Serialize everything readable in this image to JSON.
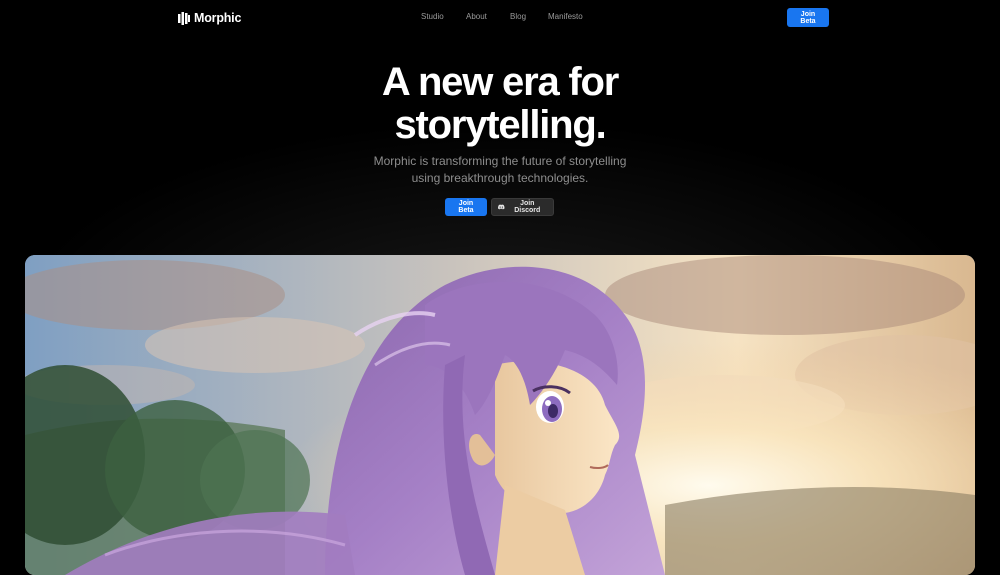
{
  "nav": {
    "brand_name": "Morphic",
    "brand_icon": "morphic-logo-icon",
    "links": [
      "Studio",
      "About",
      "Blog",
      "Manifesto"
    ],
    "cta_label": "Join Beta"
  },
  "hero": {
    "title_line1": "A new era for",
    "title_line2": "storytelling.",
    "subtitle_line1": "Morphic is transforming the future of storytelling",
    "subtitle_line2": "using breakthrough technologies.",
    "primary_cta": "Join Beta",
    "secondary_cta": "Join Discord",
    "secondary_icon": "discord-icon"
  },
  "image": {
    "alt": "anime girl with purple hair looking at sunset sky"
  },
  "colors": {
    "accent": "#1976f0",
    "background": "#000000",
    "muted_text": "#8e8e8e"
  }
}
